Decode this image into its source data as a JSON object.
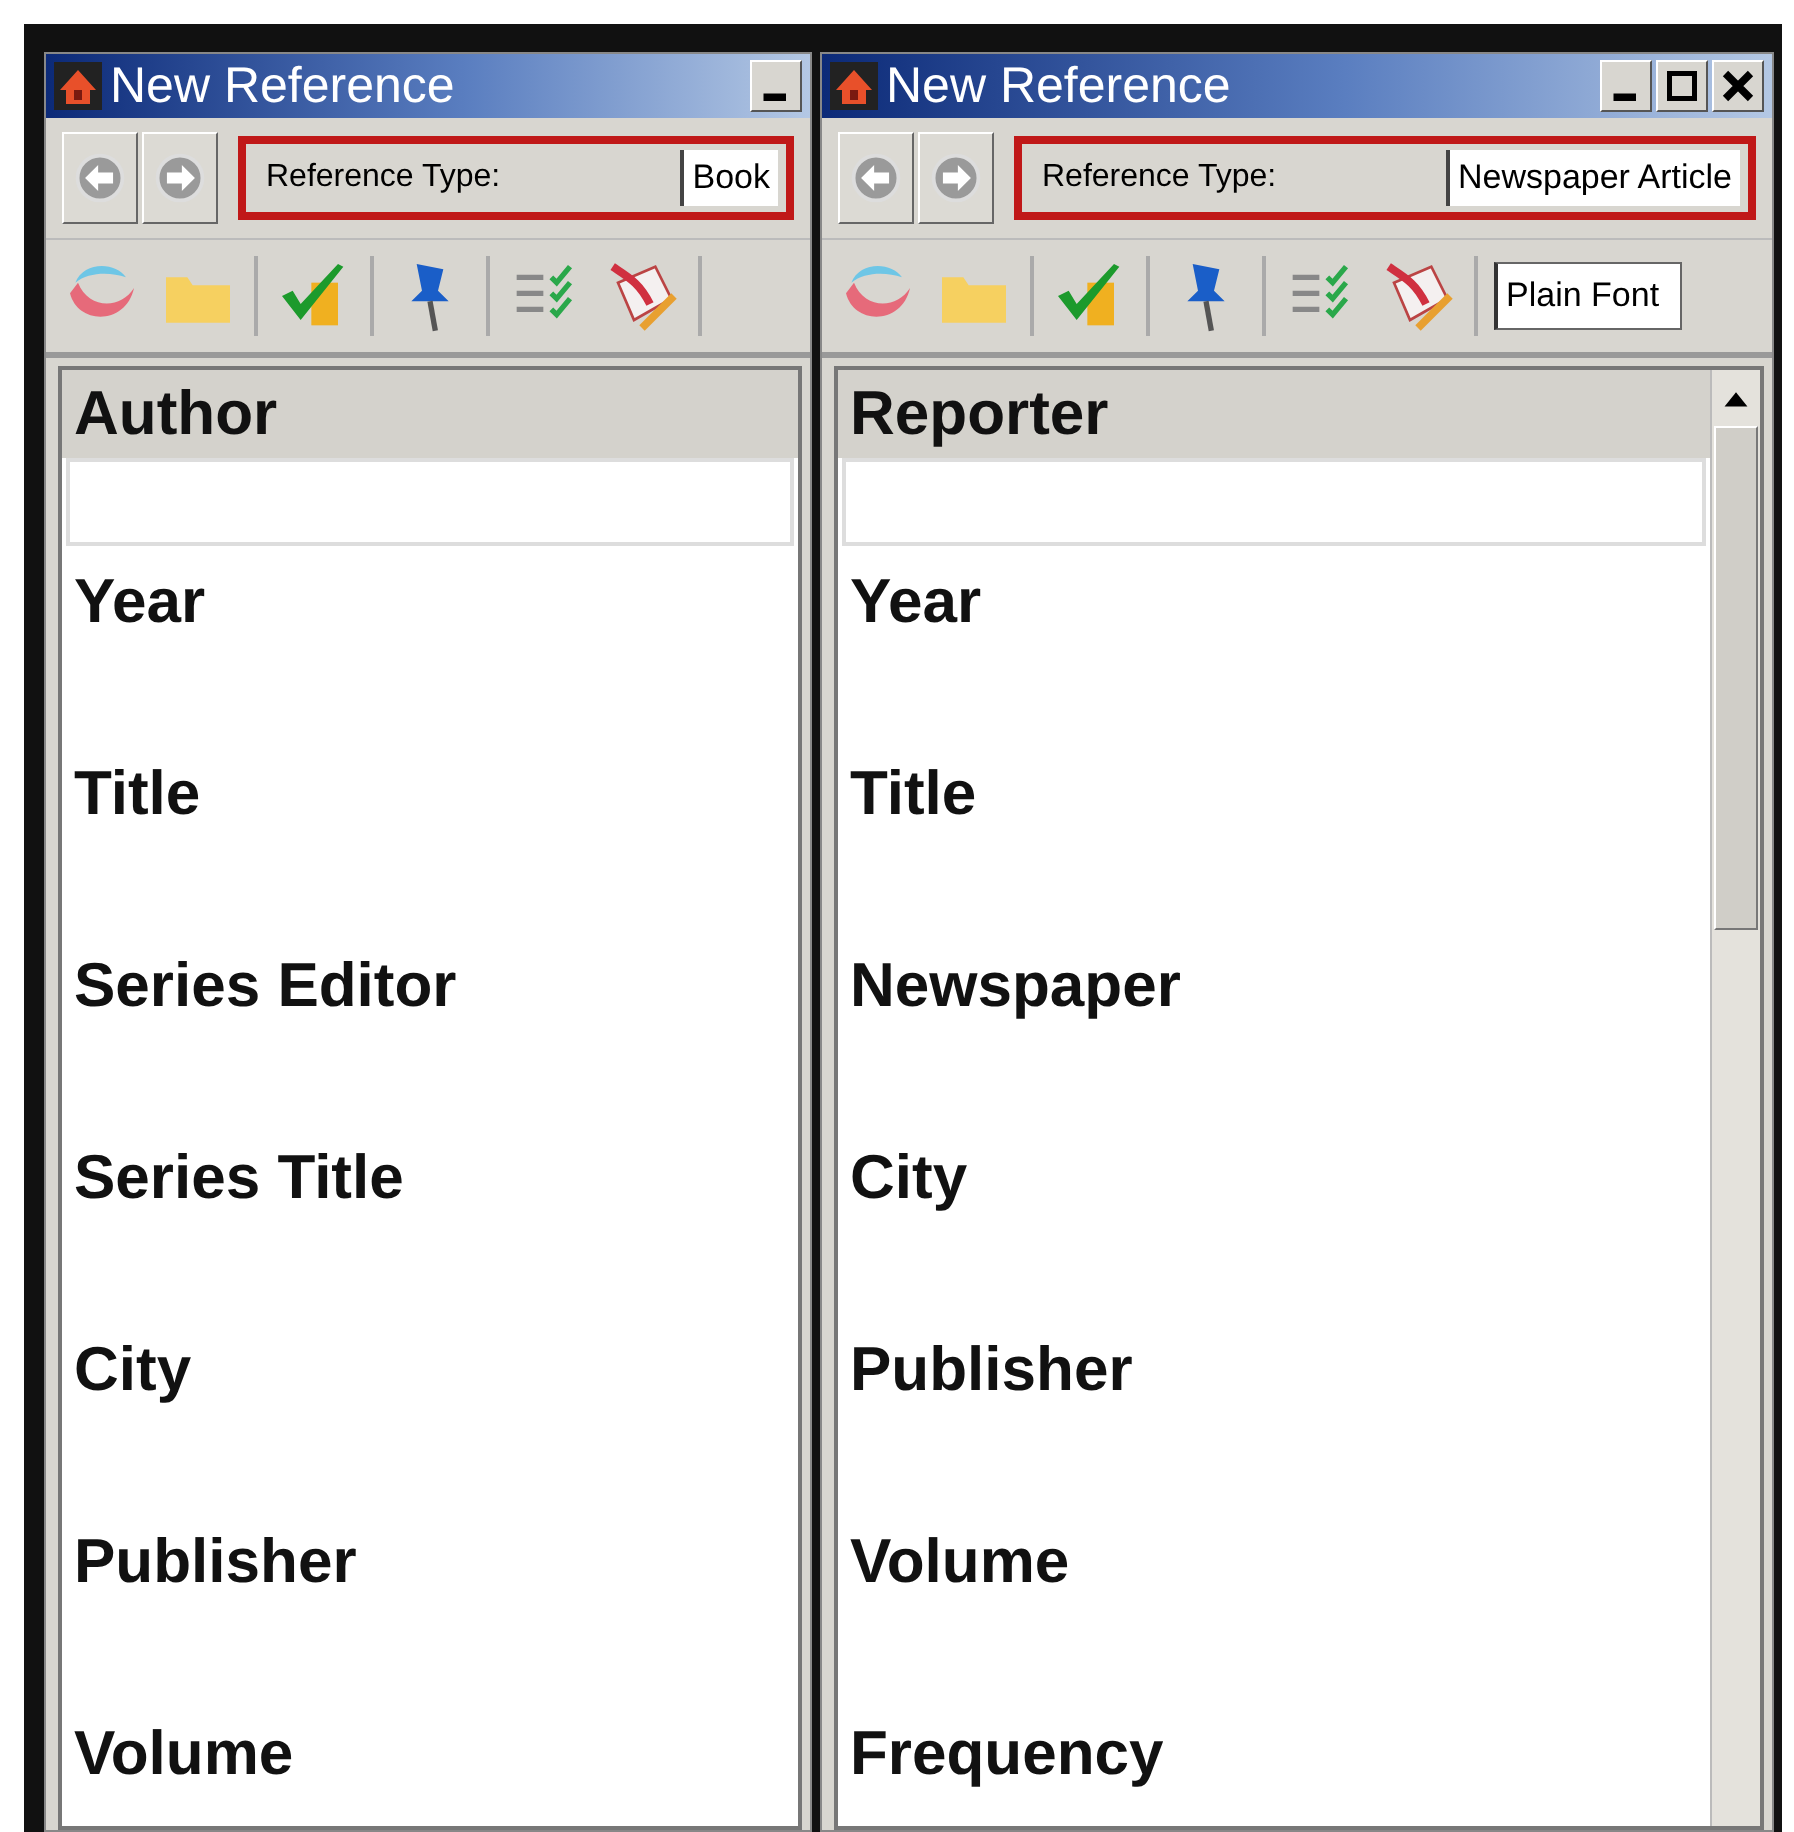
{
  "windows": [
    {
      "title": "New Reference",
      "title_buttons": [
        {
          "kind": "minimize"
        }
      ],
      "reference_type_label": "Reference Type:",
      "reference_type": "Book",
      "highlighted": true,
      "scrollbar": false,
      "fields": [
        {
          "label": "Author",
          "selected": true
        },
        {
          "label": "Year",
          "selected": false
        },
        {
          "label": "Title",
          "selected": false
        },
        {
          "label": "Series Editor",
          "selected": false
        },
        {
          "label": "Series Title",
          "selected": false
        },
        {
          "label": "City",
          "selected": false
        },
        {
          "label": "Publisher",
          "selected": false
        },
        {
          "label": "Volume",
          "selected": false
        }
      ]
    },
    {
      "title": "New Reference",
      "title_buttons": [
        {
          "kind": "minimize"
        },
        {
          "kind": "maximize"
        },
        {
          "kind": "close"
        }
      ],
      "reference_type_label": "Reference Type:",
      "reference_type": "Newspaper Article",
      "highlighted": true,
      "font": "Plain Font",
      "scrollbar": true,
      "fields": [
        {
          "label": "Reporter",
          "selected": true
        },
        {
          "label": "Year",
          "selected": false
        },
        {
          "label": "Title",
          "selected": false
        },
        {
          "label": "Newspaper",
          "selected": false
        },
        {
          "label": "City",
          "selected": false
        },
        {
          "label": "Publisher",
          "selected": false
        },
        {
          "label": "Volume",
          "selected": false
        },
        {
          "label": "Frequency",
          "selected": false
        }
      ]
    }
  ]
}
